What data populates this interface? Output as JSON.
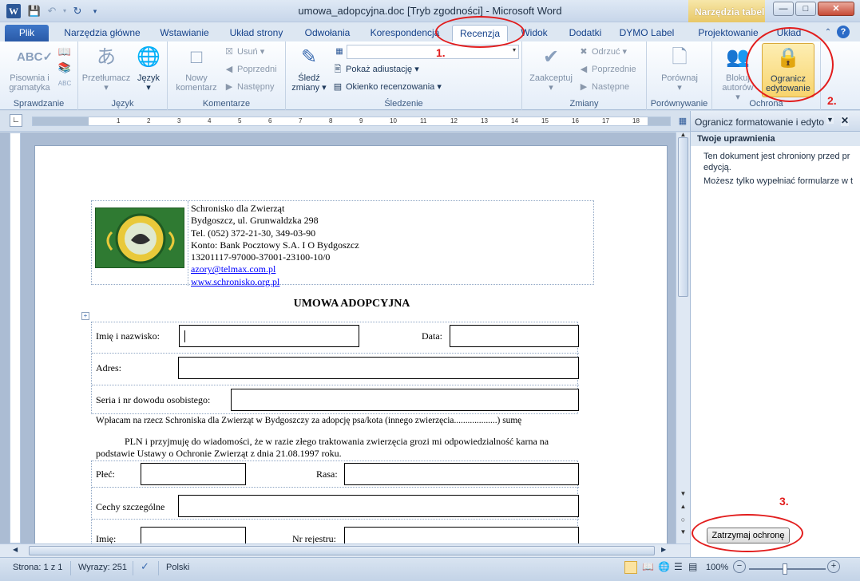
{
  "window": {
    "title": "umowa_adopcyjna.doc [Tryb zgodności] - Microsoft Word",
    "context_tab": "Narzędzia tabel"
  },
  "tabs": [
    {
      "label": "Plik"
    },
    {
      "label": "Narzędzia główne"
    },
    {
      "label": "Wstawianie"
    },
    {
      "label": "Układ strony"
    },
    {
      "label": "Odwołania"
    },
    {
      "label": "Korespondencja"
    },
    {
      "label": "Recenzja"
    },
    {
      "label": "Widok"
    },
    {
      "label": "Dodatki"
    },
    {
      "label": "DYMO Label"
    },
    {
      "label": "Projektowanie"
    },
    {
      "label": "Układ"
    }
  ],
  "ribbon": {
    "groups": {
      "sprawdzanie": "Sprawdzanie",
      "jezyk": "Język",
      "komentarze": "Komentarze",
      "sledzenie": "Śledzenie",
      "zmiany": "Zmiany",
      "porownywanie": "Porównywanie",
      "ochrona": "Ochrona"
    },
    "buttons": {
      "pisownia": "Pisownia i gramatyka",
      "przetlumacz": "Przetłumacz",
      "jezyk": "Język",
      "nowy_komentarz": "Nowy komentarz",
      "usun": "Usuń",
      "poprzedni": "Poprzedni",
      "nastepny": "Następny",
      "sledz_zmiany": "Śledź zmiany",
      "pokaz_adiustacje": "Pokaż adiustację",
      "okienko_recenzowania": "Okienko recenzowania",
      "zaakceptuj": "Zaakceptuj",
      "odrzuc": "Odrzuć",
      "poprzednie": "Poprzednie",
      "nastepne": "Następne",
      "porownaj": "Porównaj",
      "blokuj_autorow": "Blokuj autorów",
      "ogranicz_edytowanie": "Ogranicz edytowanie"
    }
  },
  "document": {
    "header": {
      "lines": [
        "Schronisko dla Zwierząt",
        "Bydgoszcz, ul. Grunwaldzka 298",
        "Tel. (052) 372-21-30, 349-03-90",
        "Konto: Bank Pocztowy S.A. I O Bydgoszcz",
        "13201117-97000-37001-23100-10/0"
      ],
      "email": "azory@telmax.com.pl",
      "website": "www.schronisko.org.pl"
    },
    "heading": "UMOWA ADOPCYJNA",
    "labels": {
      "imie_nazwisko": "Imię i nazwisko:",
      "data": "Data:",
      "adres": "Adres:",
      "dowod": "Seria i nr dowodu osobistego:",
      "plec": "Płeć:",
      "rasa": "Rasa:",
      "cechy": "Cechy szczególne",
      "imie": "Imię:",
      "nr_rejestru": "Nr rejestru:"
    },
    "paragraph1": "Wpłacam na rzecz Schroniska dla Zwierząt w Bydgoszczy za adopcję psa/kota (innego zwierzęcia...................)  sumę",
    "paragraph2_line1": "PLN i przyjmuję do wiadomości, że w razie złego traktowania zwierzęcia grozi mi odpowiedzialność karna na",
    "paragraph2_line2": "podstawie Ustawy o Ochronie Zwierząt z dnia 21.08.1997 roku."
  },
  "task_pane": {
    "title": "Ogranicz formatowanie i edyto",
    "section": "Twoje uprawnienia",
    "text_line1": "Ten dokument jest chroniony przed pr",
    "text_line2": "edycją.",
    "text_line3": "Możesz tylko wypełniać formularze w t",
    "stop_button": "Zatrzymaj ochronę"
  },
  "status": {
    "page": "Strona: 1 z 1",
    "words": "Wyrazy: 251",
    "language": "Polski",
    "zoom": "100%"
  },
  "annotations": [
    "1.",
    "2.",
    "3."
  ],
  "colors": {
    "annotation": "#e21d1d",
    "file_tab": "#2b5797",
    "highlight": "#f8d46d"
  }
}
